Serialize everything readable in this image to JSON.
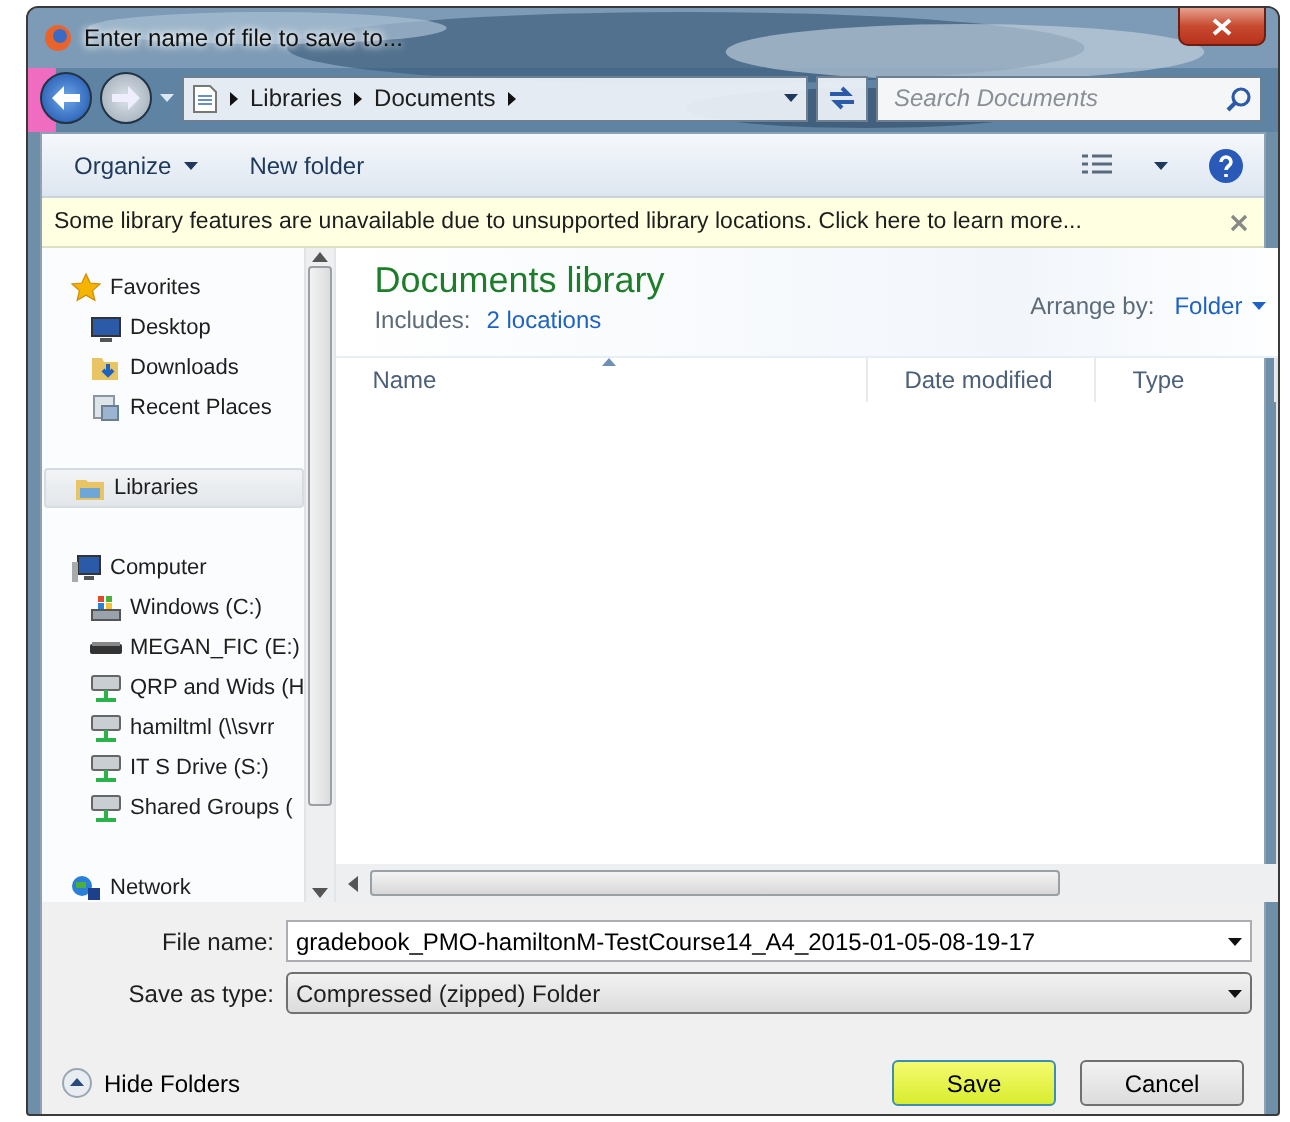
{
  "window": {
    "title": "Enter name of file to save to..."
  },
  "address": {
    "breadcrumbs": [
      "Libraries",
      "Documents"
    ]
  },
  "search": {
    "placeholder": "Search Documents"
  },
  "toolbar": {
    "buttons": [
      {
        "label": "Organize",
        "kind": "menu"
      },
      {
        "label": "New folder",
        "kind": "plain"
      }
    ]
  },
  "infobar": {
    "message": "Some library features are unavailable due to unsupported library locations. Click here to learn more..."
  },
  "sidebar": {
    "items": [
      {
        "label": "Favorites",
        "kind": "star",
        "selected": false,
        "children": [
          {
            "label": "Desktop",
            "kind": "desktop",
            "selected": false
          },
          {
            "label": "Downloads",
            "kind": "downloads",
            "selected": false
          },
          {
            "label": "Recent Places",
            "kind": "recent",
            "selected": false
          }
        ]
      },
      {
        "label": "Libraries",
        "kind": "library",
        "selected": true
      },
      {
        "label": "Computer",
        "kind": "computer",
        "selected": false,
        "children": [
          {
            "label": "Windows (C:)",
            "kind": "system-drive",
            "selected": false
          },
          {
            "label": "MEGAN_FIC (E:)",
            "kind": "usb-drive",
            "selected": false
          },
          {
            "label": "QRP and Wids (H",
            "kind": "network-drive",
            "selected": false
          },
          {
            "label": "hamiltml (\\\\svrr",
            "kind": "network-drive",
            "selected": false
          },
          {
            "label": "IT S Drive (S:)",
            "kind": "network-drive",
            "selected": false
          },
          {
            "label": "Shared Groups (",
            "kind": "network-drive",
            "selected": false
          }
        ]
      },
      {
        "label": "Network",
        "kind": "network",
        "selected": false
      }
    ]
  },
  "library": {
    "title": "Documents library",
    "includes_label": "Includes:",
    "includes_link": "2 locations",
    "arrange_label": "Arrange by:",
    "arrange_value": "Folder"
  },
  "table": {
    "columns": [
      {
        "label": "Name",
        "sorted": true
      },
      {
        "label": "Date modified",
        "sorted": false
      },
      {
        "label": "Type",
        "sorted": false
      }
    ]
  },
  "form": {
    "file_name_label": "File name:",
    "file_name": "gradebook_PMO-hamiltonM-TestCourse14_A4_2015-01-05-08-19-17",
    "type_label": "Save as type:",
    "type_value": "Compressed (zipped) Folder"
  },
  "hide_folders": "Hide Folders",
  "buttons": [
    {
      "label": "Save",
      "default": true
    },
    {
      "label": "Cancel",
      "default": false
    }
  ]
}
